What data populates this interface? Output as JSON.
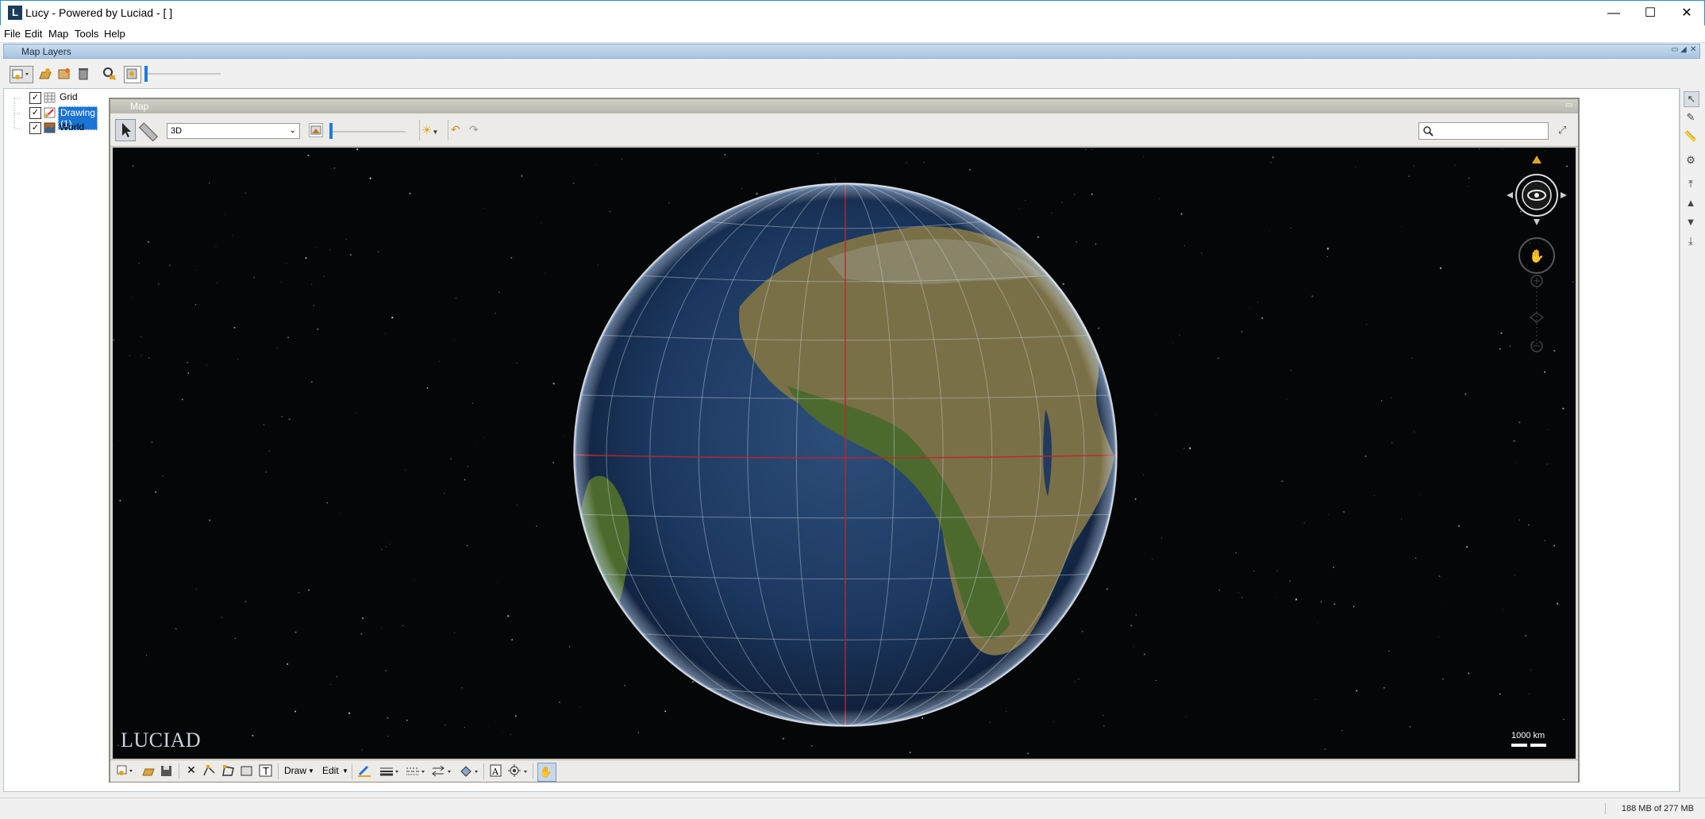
{
  "window": {
    "title": "Lucy - Powered by Luciad - [ ]",
    "minimize": "—",
    "maximize": "☐",
    "close": "✕"
  },
  "menu": [
    "File",
    "Edit",
    "Map",
    "Tools",
    "Help"
  ],
  "layers_panel": {
    "title": "Map Layers",
    "layers": [
      {
        "name": "Grid",
        "checked": true,
        "icon": "grid-layer-icon"
      },
      {
        "name": "Drawing (1)",
        "checked": true,
        "selected": true,
        "icon": "drawing-layer-icon"
      },
      {
        "name": "World",
        "checked": true,
        "icon": "raster-layer-icon"
      }
    ]
  },
  "map": {
    "title": "Map",
    "view_mode": "3D",
    "logo": "LUCIAD",
    "scale_label": "1000 km",
    "draw_menu": "Draw",
    "edit_menu": "Edit"
  },
  "status": {
    "memory": "188 MB of 277 MB"
  },
  "colors": {
    "selection": "#1b73d3",
    "space": "#050608",
    "grid_line": "#c8d2da",
    "meridian": "#c0242c"
  }
}
